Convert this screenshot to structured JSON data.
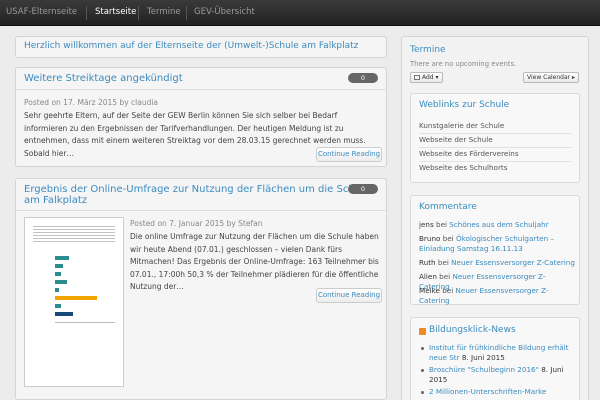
{
  "nav": {
    "items": [
      {
        "label": "USAF-Elternseite",
        "active": false
      },
      {
        "label": "Startseite",
        "active": true
      },
      {
        "label": "Termine",
        "active": false
      },
      {
        "label": "GEV-Übersicht",
        "active": false
      }
    ]
  },
  "welcome": {
    "title": "Herzlich willkommen auf der Elternseite der (Umwelt-)Schule am Falkplatz"
  },
  "posts": [
    {
      "title": "Weitere Streiktage angekündigt",
      "comments": "0",
      "meta": "Posted on 17. März 2015 by claudia",
      "excerpt": "Sehr geehrte Eltern, auf der Seite der GEW Berlin können Sie sich selber bei Bedarf informieren zu den Ergebnissen der Tarifverhandlungen. Der heutigen Meldung ist zu entnehmen, dass mit einem weiteren Streiktag vor dem 28.03.15 gerechnet werden muss. Sobald hier…",
      "button": "Continue Reading"
    },
    {
      "title_line1": "Ergebnis der Online-Umfrage zur Nutzung der Flächen um die Schule",
      "title_line2": "am Falkplatz",
      "comments": "0",
      "meta": "Posted on 7. Januar 2015 by Stefan",
      "excerpt": "Die online Umfrage zur Nutzung der Flächen um die Schule haben wir heute Abend (07.01.) geschlossen – vielen Dank fürs Mitmachen! Das Ergebnis der Online-Umfrage: 163 Teilnehmer bis 07.01., 17:00h 50,3 % der Teilnehmer plädieren für die öffentliche Nutzung der…",
      "button": "Continue Reading"
    }
  ],
  "sidebar": {
    "termine": {
      "title": "Termine",
      "empty": "There are no upcoming events.",
      "add_label": "Add",
      "view_label": "View Calendar ▸"
    },
    "weblinks": {
      "title": "Weblinks zur Schule",
      "items": [
        "Kunstgalerie der Schule",
        "Webseite der Schule",
        "Webseite des Fördervereins",
        "Webseite des Schulhorts"
      ]
    },
    "kommentare": {
      "title": "Kommentare",
      "items": [
        {
          "who": "jens",
          "sep": " bei ",
          "link": "Schönes aus dem Schuljahr"
        },
        {
          "who": "Bruno",
          "sep": " bei ",
          "link": "Ökologischer Schulgarten – Einladung Samstag 16.11.13"
        },
        {
          "who": "Ruth",
          "sep": " bei ",
          "link": "Neuer Essensversorger Z-Catering"
        },
        {
          "who": "Alien",
          "sep": " bei ",
          "link": "Neuer Essensversorger Z-Catering"
        },
        {
          "who": "Meike",
          "sep": " bei ",
          "link": "Neuer Essensversorger Z-Catering"
        }
      ]
    },
    "news": {
      "title": "Bildungsklick-News",
      "items": [
        {
          "text": "Institut für frühkindliche Bildung erhält neue Str",
          "date": "8. Juni 2015"
        },
        {
          "text": "Broschüre \"Schulbeginn 2016\"",
          "date": "8. Juni 2015"
        },
        {
          "text": "2 Millionen-Unterschriften-Marke",
          "date": ""
        }
      ]
    }
  }
}
